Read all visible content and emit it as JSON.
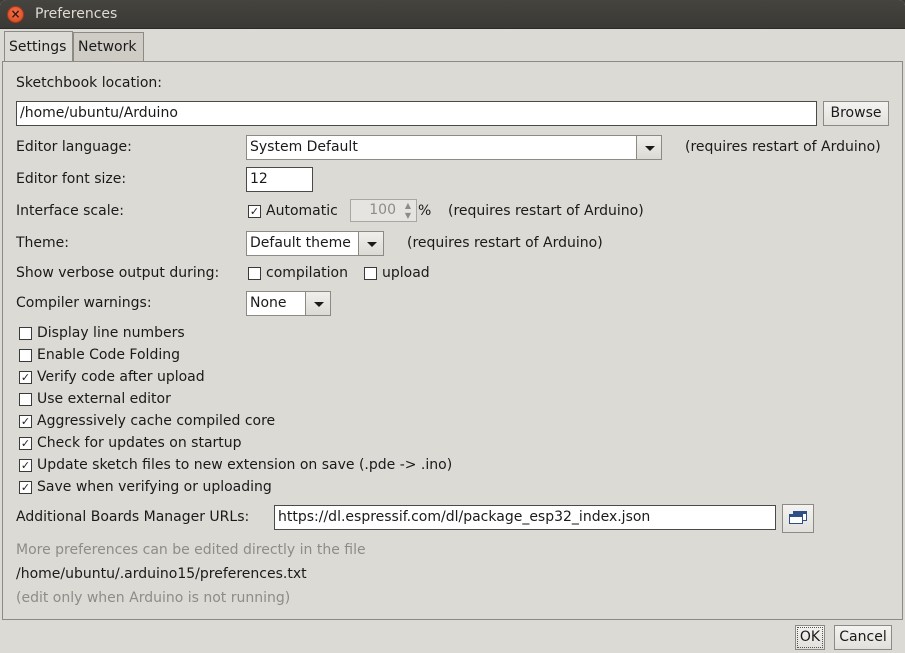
{
  "window": {
    "title": "Preferences"
  },
  "tabs": [
    {
      "label": "Settings"
    },
    {
      "label": "Network"
    }
  ],
  "settings": {
    "sketchbook_label": "Sketchbook location:",
    "sketchbook_path": "/home/ubuntu/Arduino",
    "browse_label": "Browse",
    "editor_language_label": "Editor language:",
    "editor_language_value": "System Default",
    "restart_note": "(requires restart of Arduino)",
    "font_size_label": "Editor font size:",
    "font_size_value": "12",
    "interface_scale_label": "Interface scale:",
    "automatic_label": "Automatic",
    "automatic_checked": true,
    "scale_value": "100",
    "percent": "%",
    "theme_label": "Theme:",
    "theme_value": "Default theme",
    "verbose_label": "Show verbose output during:",
    "verbose_compilation": "compilation",
    "verbose_upload": "upload",
    "compiler_warnings_label": "Compiler warnings:",
    "compiler_warnings_value": "None",
    "options": [
      {
        "label": "Display line numbers",
        "checked": false
      },
      {
        "label": "Enable Code Folding",
        "checked": false
      },
      {
        "label": "Verify code after upload",
        "checked": true
      },
      {
        "label": "Use external editor",
        "checked": false
      },
      {
        "label": "Aggressively cache compiled core",
        "checked": true
      },
      {
        "label": "Check for updates on startup",
        "checked": true
      },
      {
        "label": "Update sketch files to new extension on save (.pde -> .ino)",
        "checked": true
      },
      {
        "label": "Save when verifying or uploading",
        "checked": true
      }
    ],
    "boards_url_label": "Additional Boards Manager URLs:",
    "boards_url_value": "https://dl.espressif.com/dl/package_esp32_index.json",
    "more_prefs_note": "More preferences can be edited directly in the file",
    "prefs_file_path": "/home/ubuntu/.arduino15/preferences.txt",
    "edit_note": "(edit only when Arduino is not running)"
  },
  "footer": {
    "ok_label": "OK",
    "cancel_label": "Cancel"
  }
}
